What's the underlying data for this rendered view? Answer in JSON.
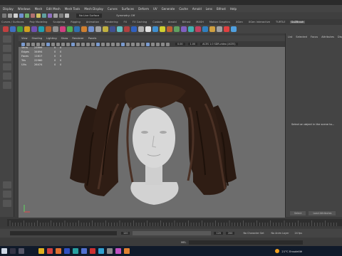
{
  "menubar": [
    "Display",
    "Windows",
    "Mesh",
    "Edit Mesh",
    "Mesh Tools",
    "Mesh Display",
    "Curves",
    "Surfaces",
    "Deform",
    "UV",
    "Generate",
    "Cache",
    "Arnold",
    "Lens",
    "Bifrost",
    "Help"
  ],
  "status": {
    "surface_label": "No Live Surface",
    "symmetry_label": "Symmetry: Off"
  },
  "shelf_tabs": [
    "Curves / Surfaces",
    "Poly Modeling",
    "Sculpting",
    "Rigging",
    "Animation",
    "Rendering",
    "FX",
    "FX Caching",
    "Custom",
    "Arnold",
    "Bifrost",
    "MASH",
    "Motion Graphics",
    "XGen",
    "XGen Interactive",
    "TURTLE",
    "GoZBrush"
  ],
  "shelf_active": "GoZBrush",
  "panel_menu": [
    "View",
    "Shading",
    "Lighting",
    "Show",
    "Renderer",
    "Panels"
  ],
  "panel_fields": {
    "value1": "0.00",
    "value2": "1.00",
    "colorspace": "ACES 1.0 SDR-video (ACES)"
  },
  "hud": [
    {
      "label": "Verts",
      "value": "23999",
      "sel": "0",
      "extra": "0"
    },
    {
      "label": "Edges",
      "value": "34694",
      "sel": "0",
      "extra": "0"
    },
    {
      "label": "Faces",
      "value": "11617",
      "sel": "0",
      "extra": "0"
    },
    {
      "label": "Tris",
      "value": "22960",
      "sel": "0",
      "extra": "0"
    },
    {
      "label": "UVs",
      "value": "26474",
      "sel": "0",
      "extra": "0"
    }
  ],
  "attr_tabs": [
    "List",
    "Selected",
    "Focus",
    "Attributes",
    "Display"
  ],
  "attr_message": "Select an object in the scene to...",
  "attr_buttons": [
    "Select",
    "Load Attributes"
  ],
  "time": {
    "start": "120",
    "end": "120",
    "field2": "200",
    "character_set": "No Character Set",
    "anim_layer": "No Anim Layer",
    "fps": "24 fps"
  },
  "cmdline": {
    "lang": "MEL"
  },
  "taskbar": {
    "weather": "21°C Ensoleillé"
  },
  "colors": {
    "viewport": "#6d6d6d",
    "ui": "#444444",
    "hair": "#2a1a12",
    "skin": "#d4d4d4"
  }
}
